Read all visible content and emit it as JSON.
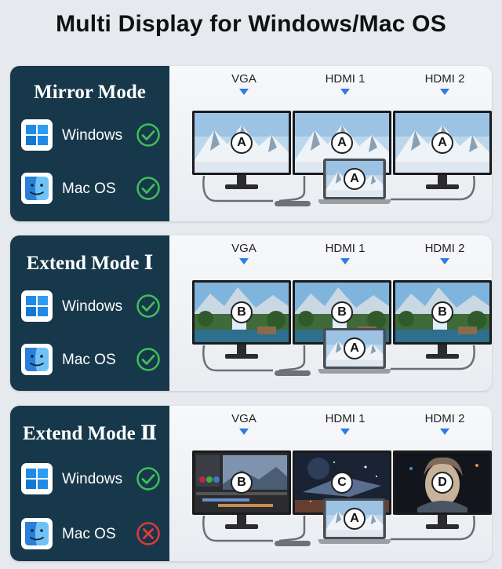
{
  "page_title": "Multi Display for Windows/Mac OS",
  "ports": [
    "VGA",
    "HDMI 1",
    "HDMI 2"
  ],
  "colors": {
    "card_bg": "#17384a",
    "check_green": "#3fbf5a",
    "cross_red": "#e03a3a",
    "port_arrow": "#2f7ae5"
  },
  "modes": [
    {
      "title": "Mirror Mode",
      "windows": {
        "label": "Windows",
        "supported": true,
        "icon": "windows-logo-icon"
      },
      "mac": {
        "label": "Mac OS",
        "supported": true,
        "icon": "finder-face-icon"
      },
      "monitors": [
        {
          "badge": "A",
          "scene": "snow-mountains"
        },
        {
          "badge": "A",
          "scene": "snow-mountains"
        },
        {
          "badge": "A",
          "scene": "snow-mountains"
        }
      ],
      "laptop_badge": "A"
    },
    {
      "title": "Extend Mode Ⅰ",
      "windows": {
        "label": "Windows",
        "supported": true,
        "icon": "windows-logo-icon"
      },
      "mac": {
        "label": "Mac OS",
        "supported": true,
        "icon": "finder-face-icon"
      },
      "monitors": [
        {
          "badge": "B",
          "scene": "waterfall"
        },
        {
          "badge": "B",
          "scene": "waterfall"
        },
        {
          "badge": "B",
          "scene": "waterfall"
        }
      ],
      "laptop_badge": "A"
    },
    {
      "title": "Extend Mode Ⅱ",
      "windows": {
        "label": "Windows",
        "supported": true,
        "icon": "windows-logo-icon"
      },
      "mac": {
        "label": "Mac OS",
        "supported": false,
        "icon": "finder-face-icon"
      },
      "monitors": [
        {
          "badge": "B",
          "scene": "editing-app"
        },
        {
          "badge": "C",
          "scene": "space-ship"
        },
        {
          "badge": "D",
          "scene": "cyborg-portrait"
        }
      ],
      "laptop_badge": "A"
    }
  ]
}
